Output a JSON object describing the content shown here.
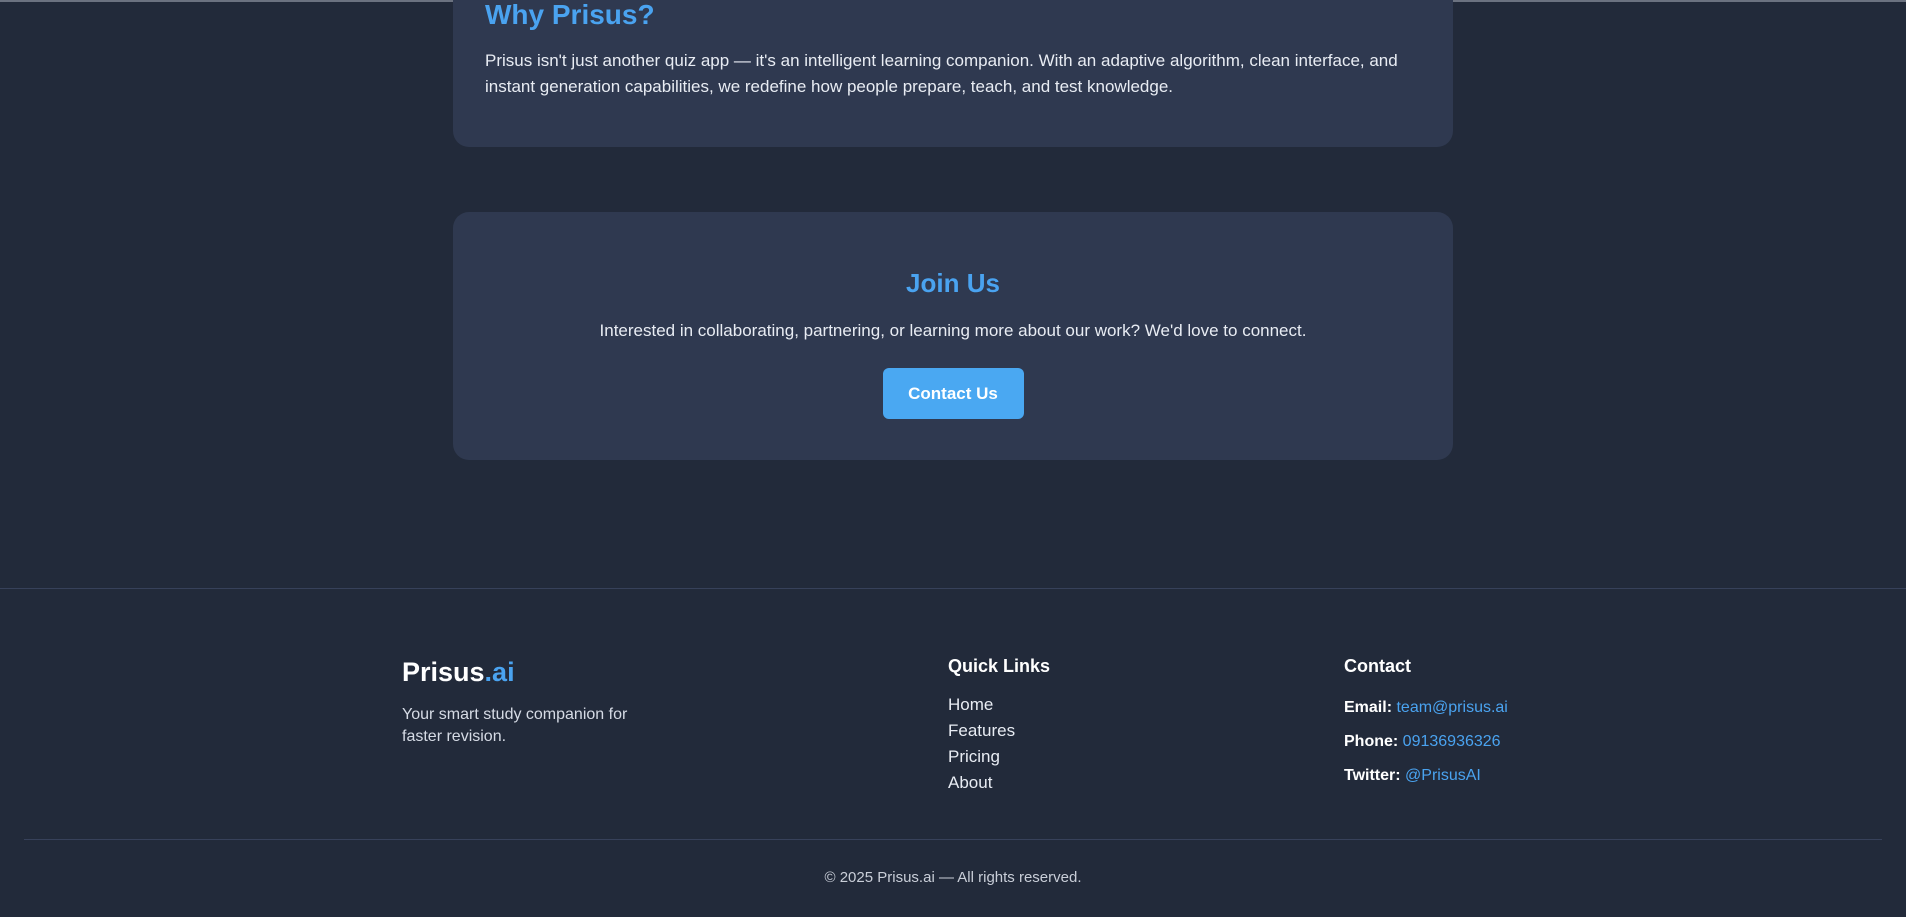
{
  "why": {
    "title": "Why Prisus?",
    "body": "Prisus isn't just another quiz app — it's an intelligent learning companion. With an adaptive algorithm, clean interface, and instant generation capabilities, we redefine how people prepare, teach, and test knowledge."
  },
  "join": {
    "title": "Join Us",
    "body": "Interested in collaborating, partnering, or learning more about our work? We'd love to connect.",
    "button_label": "Contact Us"
  },
  "footer": {
    "brand_main": "Prisus",
    "brand_accent": ".ai",
    "tagline": "Your smart study companion for faster revision.",
    "quick_links_title": "Quick Links",
    "quick_links": [
      "Home",
      "Features",
      "Pricing",
      "About"
    ],
    "contact_title": "Contact",
    "contact": {
      "email_label": "Email:",
      "email": "team@prisus.ai",
      "phone_label": "Phone:",
      "phone": "09136936326",
      "twitter_label": "Twitter:",
      "twitter": "@PrisusAI"
    },
    "copyright": "© 2025 Prisus.ai — All rights reserved."
  },
  "colors": {
    "background": "#222a3a",
    "card": "#2f3950",
    "accent": "#4aa3f0",
    "button": "#4aa8f2"
  }
}
